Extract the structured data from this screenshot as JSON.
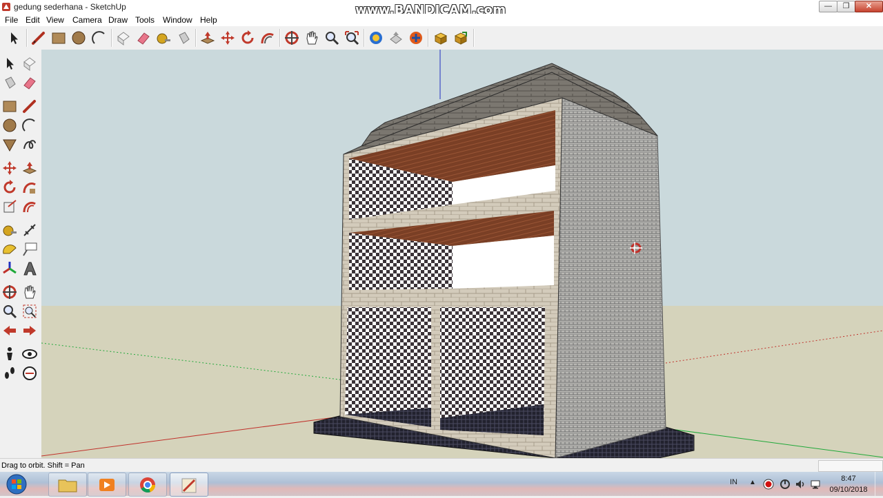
{
  "window": {
    "title": "gedung sederhana - SketchUp",
    "watermark": "www.BANDICAM.com"
  },
  "window_controls": {
    "minimize": "—",
    "maximize": "❐",
    "close": "✕"
  },
  "menu": [
    "File",
    "Edit",
    "View",
    "Camera",
    "Draw",
    "Tools",
    "Window",
    "Help"
  ],
  "toolbar": {
    "tools": [
      "select-icon",
      "line-icon",
      "rectangle-icon",
      "circle-icon",
      "arc-icon",
      "make-component-icon",
      "eraser-icon",
      "tape-measure-icon",
      "paint-bucket-icon",
      "push-pull-icon",
      "move-icon",
      "rotate-icon",
      "follow-me-icon",
      "orbit-icon",
      "pan-icon",
      "zoom-icon",
      "zoom-extents-icon",
      "get-models-icon",
      "share-model-icon",
      "add-location-icon",
      "components-icon",
      "3d-warehouse-icon"
    ]
  },
  "left_toolbar": {
    "tools": [
      "select-icon",
      "make-component-icon",
      "paint-bucket-icon",
      "eraser-icon",
      "rectangle-icon",
      "line-icon",
      "circle-icon",
      "arc-icon",
      "polygon-icon",
      "freehand-icon",
      "move-icon",
      "push-pull-icon",
      "rotate-icon",
      "follow-me-icon",
      "scale-icon",
      "offset-icon",
      "tape-measure-icon",
      "dimension-icon",
      "protractor-icon",
      "text-icon",
      "axes-icon",
      "3d-text-icon",
      "orbit-icon",
      "pan-icon",
      "zoom-icon",
      "zoom-window-icon",
      "previous-view-icon",
      "next-view-icon",
      "position-camera-icon",
      "look-around-icon",
      "walk-icon",
      "section-plane-icon"
    ]
  },
  "status": {
    "hint": "Drag to orbit.  Shift = Pan"
  },
  "taskbar": {
    "apps": [
      "explorer-icon",
      "media-player-icon",
      "chrome-icon",
      "sketchup-icon"
    ],
    "tray_language": "IN",
    "tray_expand": "▲",
    "time": "8:47",
    "date": "09/10/2018"
  },
  "colors": {
    "sky": "#cad9dc",
    "ground": "#d5d3bb",
    "wall": "#cfc7b6",
    "wood": "#7a3f25",
    "axis_red": "#c0302a",
    "axis_green": "#1ea838",
    "axis_blue": "#2030c0"
  }
}
